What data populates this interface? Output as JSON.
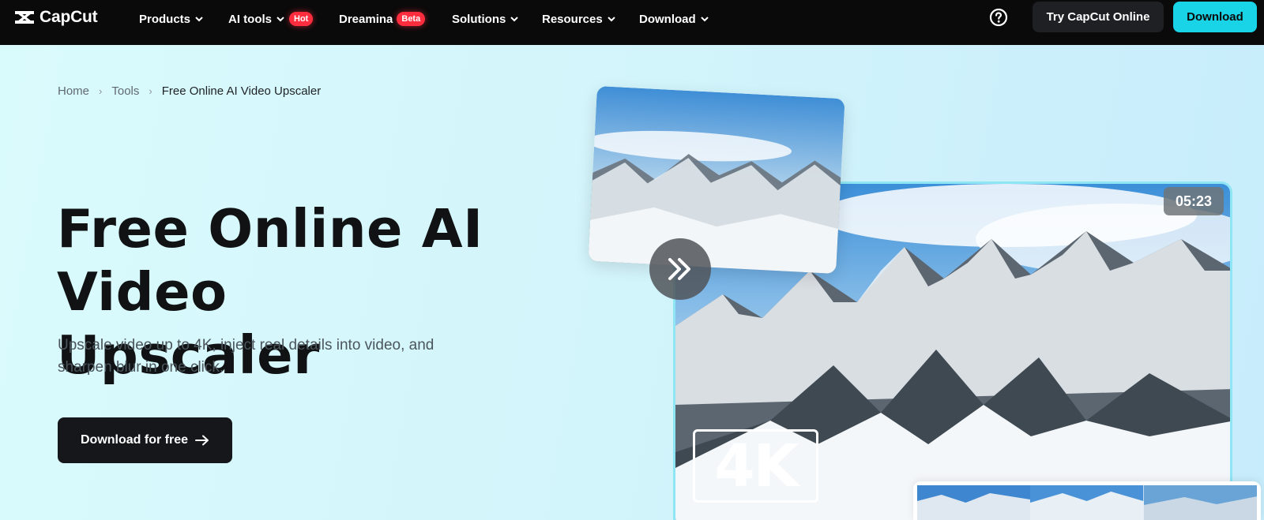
{
  "brand": {
    "name": "CapCut"
  },
  "nav": {
    "items": [
      {
        "label": "Products"
      },
      {
        "label": "AI tools",
        "badge": "Hot"
      },
      {
        "label": "Dreamina",
        "badge": "Beta"
      },
      {
        "label": "Solutions"
      },
      {
        "label": "Resources"
      },
      {
        "label": "Download"
      }
    ],
    "help_icon": "question-circle-icon",
    "try_online": "Try CapCut Online",
    "download": "Download"
  },
  "breadcrumb": {
    "items": [
      "Home",
      "Tools",
      "Free Online AI Video Upscaler"
    ]
  },
  "hero": {
    "title": "Free Online AI Video Upscaler",
    "subtitle": "Upscale video up to 4K, inject real details into video, and sharpen blur in one click.",
    "cta": "Download for free"
  },
  "preview": {
    "duration": "05:23",
    "resolution_badge": "4K",
    "compare_icon": "double-chevron-right-icon"
  },
  "colors": {
    "nav_bg": "#0a0a0b",
    "accent": "#19d3e6",
    "badge_red": "#ff2d3d",
    "hero_bg": "#d3f5fb"
  }
}
